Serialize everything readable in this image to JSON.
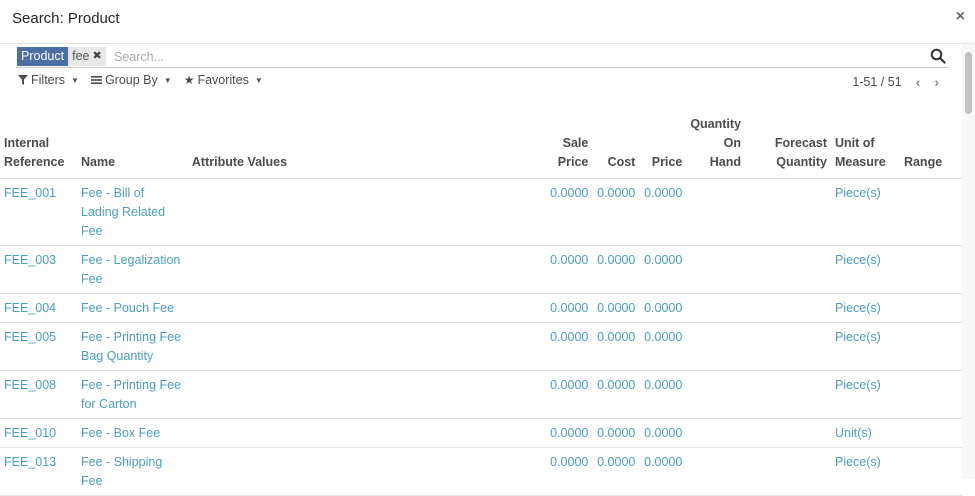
{
  "modal": {
    "title": "Search: Product",
    "close_label": "×"
  },
  "search": {
    "facet_label": "Product",
    "facet_value": "fee",
    "facet_remove": "✖",
    "placeholder": "Search..."
  },
  "toolbar": {
    "filters_label": "Filters",
    "groupby_label": "Group By",
    "favorites_label": "Favorites"
  },
  "pager": {
    "value": "1-51 / 51",
    "prev": "‹",
    "next": "›"
  },
  "table": {
    "headers": {
      "internal_ref": [
        "Internal",
        "Reference"
      ],
      "name": "Name",
      "attribute_values": "Attribute Values",
      "sale_price": [
        "Sale",
        "Price"
      ],
      "cost": "Cost",
      "price": "Price",
      "qty_on_hand": [
        "Quantity",
        "On",
        "Hand"
      ],
      "forecast_qty": [
        "Forecast",
        "Quantity"
      ],
      "uom": [
        "Unit of",
        "Measure"
      ],
      "range": "Range"
    },
    "rows": [
      {
        "ref": "FEE_001",
        "name": [
          "Fee - Bill of",
          "Lading Related",
          "Fee"
        ],
        "sale_price": "0.0000",
        "cost": "0.0000",
        "price": "0.0000",
        "uom": "Piece(s)"
      },
      {
        "ref": "FEE_003",
        "name": [
          "Fee - Legalization",
          "Fee"
        ],
        "sale_price": "0.0000",
        "cost": "0.0000",
        "price": "0.0000",
        "uom": "Piece(s)"
      },
      {
        "ref": "FEE_004",
        "name": [
          "Fee - Pouch Fee"
        ],
        "sale_price": "0.0000",
        "cost": "0.0000",
        "price": "0.0000",
        "uom": "Piece(s)"
      },
      {
        "ref": "FEE_005",
        "name": [
          "Fee - Printing Fee",
          "Bag Quantity"
        ],
        "sale_price": "0.0000",
        "cost": "0.0000",
        "price": "0.0000",
        "uom": "Piece(s)"
      },
      {
        "ref": "FEE_008",
        "name": [
          "Fee - Printing Fee",
          "for Carton"
        ],
        "sale_price": "0.0000",
        "cost": "0.0000",
        "price": "0.0000",
        "uom": "Piece(s)"
      },
      {
        "ref": "FEE_010",
        "name": [
          "Fee - Box Fee"
        ],
        "sale_price": "0.0000",
        "cost": "0.0000",
        "price": "0.0000",
        "uom": "Unit(s)"
      },
      {
        "ref": "FEE_013",
        "name": [
          "Fee - Shipping",
          "Fee"
        ],
        "sale_price": "0.0000",
        "cost": "0.0000",
        "price": "0.0000",
        "uom": "Piece(s)"
      }
    ]
  },
  "colors": {
    "facet_bg": "#4a6fa5",
    "link": "#4a9fbd"
  }
}
